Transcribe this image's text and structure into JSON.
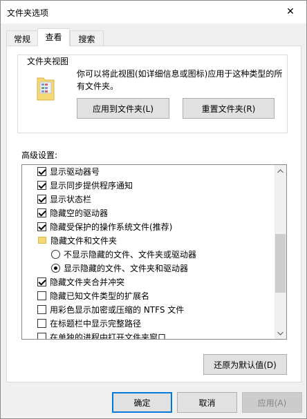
{
  "window": {
    "title": "文件夹选项",
    "close_glyph": "✕"
  },
  "tabs": [
    {
      "label": "常规",
      "active": false
    },
    {
      "label": "查看",
      "active": true
    },
    {
      "label": "搜索",
      "active": false
    }
  ],
  "folder_views": {
    "group_title": "文件夹视图",
    "description": "你可以将此视图(如详细信息或图标)应用于这种类型的所有文件夹。",
    "apply_button": "应用到文件夹(L)",
    "reset_button": "重置文件夹(R)"
  },
  "advanced": {
    "label": "高级设置:",
    "items": [
      {
        "type": "checkbox",
        "checked": true,
        "label": "显示驱动器号"
      },
      {
        "type": "checkbox",
        "checked": true,
        "label": "显示同步提供程序通知"
      },
      {
        "type": "checkbox",
        "checked": true,
        "label": "显示状态栏"
      },
      {
        "type": "checkbox",
        "checked": true,
        "label": "隐藏空的驱动器"
      },
      {
        "type": "checkbox",
        "checked": true,
        "label": "隐藏受保护的操作系统文件(推荐)"
      },
      {
        "type": "folder",
        "label": "隐藏文件和文件夹"
      },
      {
        "type": "radio",
        "checked": false,
        "label": "不显示隐藏的文件、文件夹或驱动器"
      },
      {
        "type": "radio",
        "checked": true,
        "label": "显示隐藏的文件、文件夹和驱动器"
      },
      {
        "type": "checkbox",
        "checked": true,
        "label": "隐藏文件夹合并冲突"
      },
      {
        "type": "checkbox",
        "checked": false,
        "label": "隐藏已知文件类型的扩展名"
      },
      {
        "type": "checkbox",
        "checked": false,
        "label": "用彩色显示加密或压缩的 NTFS 文件"
      },
      {
        "type": "checkbox",
        "checked": false,
        "label": "在标题栏中显示完整路径"
      },
      {
        "type": "checkbox",
        "checked": false,
        "label": "在单独的进程中打开文件夹窗口"
      }
    ],
    "restore_defaults_button": "还原为默认值(D)"
  },
  "footer": {
    "ok_button": "确定",
    "cancel_button": "取消",
    "apply_button": "应用(A)"
  },
  "colors": {
    "window_bg": "#f0f0f0",
    "panel_bg": "#ffffff",
    "button_bg": "#e1e1e1",
    "accent": "#0078d7",
    "folder_yellow": "#f5d774"
  }
}
